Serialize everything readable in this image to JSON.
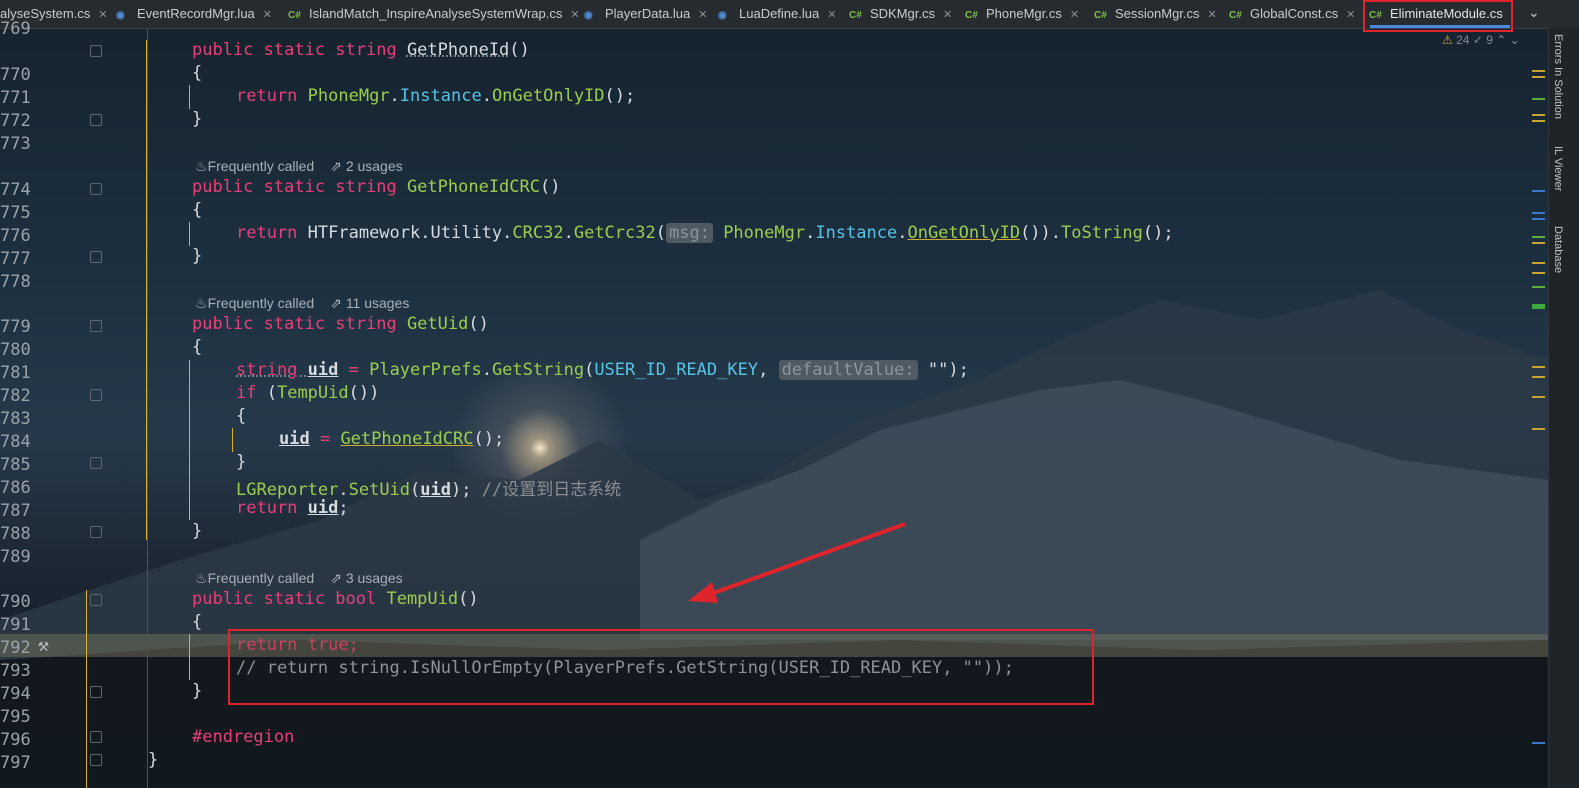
{
  "tabs": [
    {
      "icon": "",
      "label": "alyseSystem.cs"
    },
    {
      "icon": "lua",
      "label": "EventRecordMgr.lua"
    },
    {
      "icon": "C#",
      "label": "IslandMatch_InspireAnalyseSystemWrap.cs"
    },
    {
      "icon": "lua",
      "label": "PlayerData.lua"
    },
    {
      "icon": "lua",
      "label": "LuaDefine.lua"
    },
    {
      "icon": "C#",
      "label": "SDKMgr.cs"
    },
    {
      "icon": "C#",
      "label": "PhoneMgr.cs"
    },
    {
      "icon": "C#",
      "label": "SessionMgr.cs"
    },
    {
      "icon": "C#",
      "label": "GlobalConst.cs"
    },
    {
      "icon": "C#",
      "label": "EliminateModule.cs",
      "active": true
    }
  ],
  "inspections": {
    "warnings": "24",
    "weak": "9"
  },
  "right_panels": [
    "Errors In Solution",
    "IL Viewer",
    "Database"
  ],
  "line_numbers": [
    "769",
    "770",
    "771",
    "772",
    "773",
    "774",
    "775",
    "776",
    "777",
    "778",
    "779",
    "780",
    "781",
    "782",
    "783",
    "784",
    "785",
    "786",
    "787",
    "788",
    "789",
    "790",
    "791",
    "792",
    "793",
    "794",
    "795",
    "796",
    "797"
  ],
  "annotations": {
    "getPhoneIdCRC": {
      "freq": "Frequently called",
      "usages": "2 usages"
    },
    "getUid": {
      "freq": "Frequently called",
      "usages": "11 usages"
    },
    "tempUid": {
      "freq": "Frequently called",
      "usages": "3 usages"
    }
  },
  "code": {
    "l769": {
      "kw": "public static string ",
      "fn": "GetPhoneId",
      "rest": "()"
    },
    "l770": "{",
    "l771": {
      "kw": "return ",
      "cl": "PhoneMgr",
      "p1": ".",
      "pr": "Instance",
      "p2": ".",
      "fn": "OnGetOnlyID",
      "rest": "();"
    },
    "l772": "}",
    "l774": {
      "kw": "public static string ",
      "fn": "GetPhoneIdCRC",
      "rest": "()"
    },
    "l775": "{",
    "l776": {
      "kw": "return ",
      "t1": "HTFramework",
      "t2": ".",
      "t3": "Utility",
      "t4": ".",
      "cl": "CRC32",
      "t5": ".",
      "fn": "GetCrc32",
      "t6": "(",
      "hint": "msg:",
      "t7": " ",
      "cl2": "PhoneMgr",
      "t8": ".",
      "pr": "Instance",
      "t9": ".",
      "fn2": "OnGetOnlyID",
      "t10": "()).",
      "fn3": "ToString",
      "t11": "();"
    },
    "l777": "}",
    "l779": {
      "kw": "public static string ",
      "fn": "GetUid",
      "rest": "()"
    },
    "l780": "{",
    "l781": {
      "ty": "string ",
      "v": "uid",
      "t1": " = ",
      "cl": "PlayerPrefs",
      "t2": ".",
      "fn": "GetString",
      "t3": "(",
      "pr": "USER_ID_READ_KEY",
      "t4": ", ",
      "hint": "defaultValue:",
      "t5": " \"\");"
    },
    "l782": {
      "kw": "if ",
      "t1": "(",
      "fn": "TempUid",
      "t2": "())"
    },
    "l783": "{",
    "l784": {
      "v": "uid",
      "t1": " = ",
      "fn": "GetPhoneIdCRC",
      "t2": "();"
    },
    "l785": "}",
    "l786": {
      "cl": "LGReporter",
      "t1": ".",
      "fn": "SetUid",
      "t2": "(",
      "v": "uid",
      "t3": "); ",
      "cm": "//设置到日志系统"
    },
    "l787": {
      "kw": "return ",
      "v": "uid",
      "t1": ";"
    },
    "l788": "}",
    "l790": {
      "kw": "public static bool ",
      "fn": "TempUid",
      "rest": "()"
    },
    "l791": "{",
    "l792": "return true;",
    "l793": "// return string.IsNullOrEmpty(PlayerPrefs.GetString(USER_ID_READ_KEY, \"\"));",
    "l794": "}",
    "l796": "#endregion",
    "l797": "}"
  }
}
